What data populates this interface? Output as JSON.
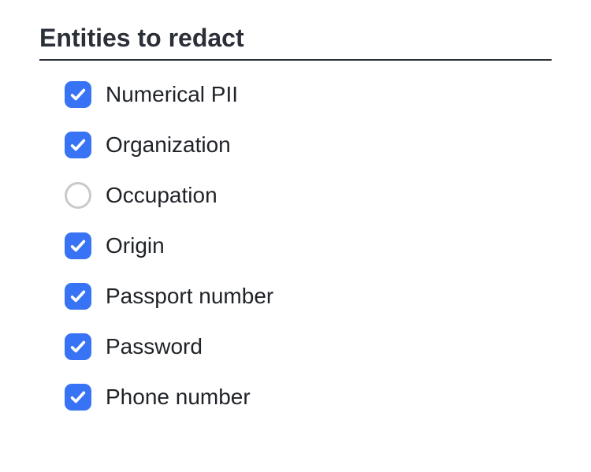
{
  "section": {
    "title": "Entities to redact"
  },
  "entities": [
    {
      "label": "Numerical PII",
      "checked": true
    },
    {
      "label": "Organization",
      "checked": true
    },
    {
      "label": "Occupation",
      "checked": false
    },
    {
      "label": "Origin",
      "checked": true
    },
    {
      "label": "Passport number",
      "checked": true
    },
    {
      "label": "Password",
      "checked": true
    },
    {
      "label": "Phone number",
      "checked": true
    }
  ],
  "colors": {
    "accent": "#3773f4",
    "text": "#1f2328",
    "heading": "#2a2f38",
    "unchecked_border": "#c7c9cc"
  }
}
